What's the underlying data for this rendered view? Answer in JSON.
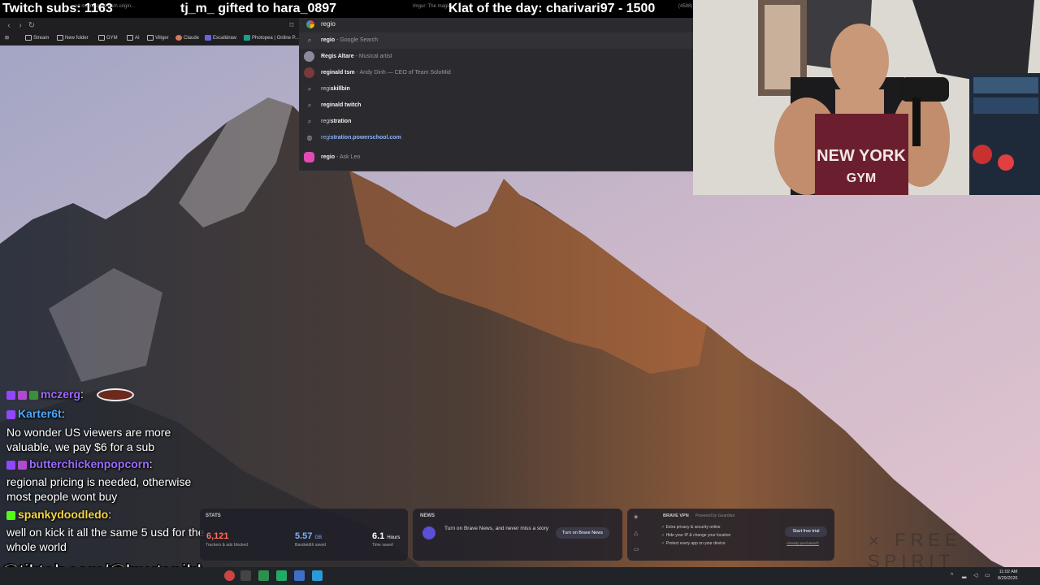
{
  "stream_overlay": {
    "subs_text": "Twitch subs: 1163",
    "gift_text": "tj_m_ gifted to hara_0897",
    "klat_text": "Klat of the day: charivari97 - 1500",
    "ghost_tabs": [
      "od morning vietnam origin...",
      "Imgur: The magic...",
      "(4588)"
    ]
  },
  "browser": {
    "address_value": "regio",
    "bookmarks": [
      {
        "label": "Stream",
        "icon": "folder-icon"
      },
      {
        "label": "New folder",
        "icon": "folder-icon"
      },
      {
        "label": "GYM",
        "icon": "folder-icon"
      },
      {
        "label": "AI",
        "icon": "folder-icon"
      },
      {
        "label": "Viliger",
        "icon": "folder-icon"
      },
      {
        "label": "Claude",
        "icon": "claude-icon"
      },
      {
        "label": "Excalidraw",
        "icon": "excalidraw-icon"
      },
      {
        "label": "Photopea | Online P...",
        "icon": "photopea-icon"
      }
    ],
    "suggestions": [
      {
        "bold": "regio",
        "rest": "",
        "desc": " - Google Search",
        "icon": "search-icon"
      },
      {
        "bold": "Regis Altare",
        "rest": "",
        "desc": " - Musical artist",
        "icon": "avatar-icon"
      },
      {
        "bold": "reginald tsm",
        "rest": "",
        "desc": " - Andy Dinh — CEO of Team SoloMid",
        "icon": "avatar-icon"
      },
      {
        "bold": "regi",
        "rest": "skillbin",
        "desc": "",
        "icon": "search-icon"
      },
      {
        "bold": "reginald twitch",
        "rest": "",
        "desc": "",
        "icon": "search-icon"
      },
      {
        "bold": "regi",
        "rest": "stration",
        "desc": "",
        "icon": "search-icon"
      },
      {
        "bold": "regi",
        "rest": "stration.powerschool.com",
        "desc": "",
        "icon": "globe-icon"
      },
      {
        "bold": "regio",
        "rest": "",
        "desc": " - Ask Leo",
        "icon": "leo-icon"
      }
    ]
  },
  "chat": {
    "messages": [
      {
        "user": "mczerg",
        "text": ":",
        "user_color": "#9b6bff"
      },
      {
        "user": "Karter6t",
        "text": ":",
        "user_color": "#4aa8ff"
      },
      {
        "user": "",
        "text": "No wonder US viewers are more",
        "user_color": ""
      },
      {
        "user": "",
        "text": "valuable, we pay $6 for a sub",
        "user_color": ""
      },
      {
        "user": "butterchickenpopcorn",
        "text": ":",
        "user_color": "#9b6bff"
      },
      {
        "user": "",
        "text": "regional pricing is needed, otherwise",
        "user_color": ""
      },
      {
        "user": "",
        "text": "most people wont buy",
        "user_color": ""
      },
      {
        "user": "spankydoodledo",
        "text": ":",
        "user_color": "#f5d442"
      },
      {
        "user": "",
        "text": "well on kick it all the same 5 usd for the",
        "user_color": ""
      },
      {
        "user": "",
        "text": "whole world",
        "user_color": ""
      }
    ],
    "tiktok": "@tiktok.com/@knutspild"
  },
  "brave": {
    "stats": {
      "header": "STATS",
      "items": [
        {
          "value": "6,121",
          "unit": "",
          "label": "Trackers & ads blocked",
          "color": "#ff6f55"
        },
        {
          "value": "5.57",
          "unit": "GB",
          "label": "Bandwidth saved",
          "color": "#7fb2ff"
        },
        {
          "value": "6.1",
          "unit": "Hours",
          "label": "Time saved",
          "color": "#ffffff"
        }
      ]
    },
    "news": {
      "header": "NEWS",
      "text": "Turn on Brave News, and never miss a story",
      "button": "Turn on Brave News"
    },
    "vpn": {
      "header": "BRAVE VPN",
      "powered": "Powered by Guardian",
      "features": [
        "Extra privacy & security online",
        "Hide your IP & change your location",
        "Protect every app on your device"
      ],
      "button": "Start free trial",
      "secondary": "Already purchased?"
    }
  },
  "watermark": "FREE SPIRIT",
  "taskbar": {
    "time": "11:02 AM",
    "date": "8/29/2026"
  }
}
